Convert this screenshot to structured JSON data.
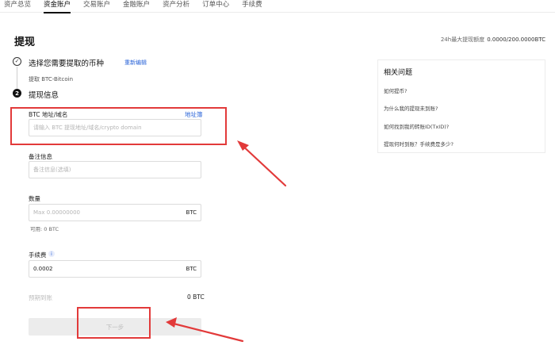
{
  "nav": {
    "tabs": [
      {
        "label": "资产总览",
        "active": false
      },
      {
        "label": "资金账户",
        "active": true
      },
      {
        "label": "交易账户",
        "active": false
      },
      {
        "label": "金融账户",
        "active": false
      },
      {
        "label": "资产分析",
        "active": false
      },
      {
        "label": "订单中心",
        "active": false
      },
      {
        "label": "手续费",
        "active": false
      }
    ]
  },
  "page": {
    "title": "提现",
    "limit_label": "24h最大提现额度",
    "limit_value": "0.0000/200.0000BTC"
  },
  "step1": {
    "check": "✓",
    "title": "选择您需要提取的币种",
    "reedit": "重新编辑",
    "subtitle": "提取 BTC-Bitcoin"
  },
  "step2": {
    "number": "2",
    "title": "提现信息"
  },
  "form": {
    "address": {
      "label": "BTC 地址/域名",
      "link": "地址簿",
      "placeholder": "请输入 BTC 提现地址/域名/crypto domain"
    },
    "memo": {
      "label": "备注信息",
      "placeholder": "备注信息(选填)"
    },
    "amount": {
      "label": "数量",
      "placeholder": "Max 0.00000000",
      "unit": "BTC",
      "available": "可用:  0 BTC"
    },
    "fee": {
      "label": "手续费",
      "info": "i",
      "value": "0.0002",
      "unit": "BTC"
    },
    "expected": {
      "label": "预期到账",
      "value": "0 BTC"
    },
    "next_label": "下一步"
  },
  "faq": {
    "title": "相关问题",
    "items": [
      "如何提币?",
      "为什么我的提现未到账?",
      "如何找到我的转账ID(TxID)?",
      "提现何时到账？手续费是多少?"
    ]
  },
  "annotation_color": "#e23a3a"
}
